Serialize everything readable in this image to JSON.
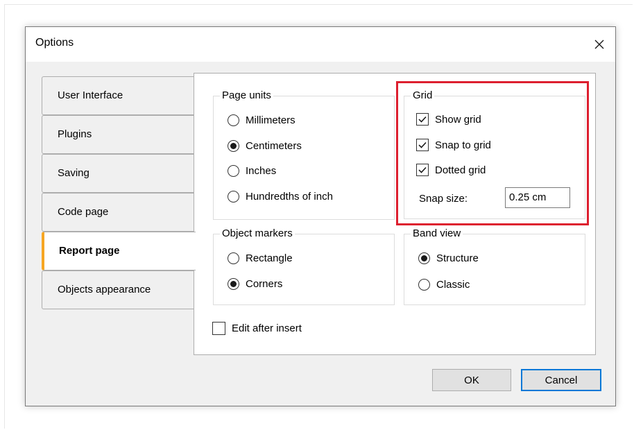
{
  "window": {
    "title": "Options"
  },
  "tabs": [
    {
      "label": "User Interface",
      "active": false
    },
    {
      "label": "Plugins",
      "active": false
    },
    {
      "label": "Saving",
      "active": false
    },
    {
      "label": "Code page",
      "active": false
    },
    {
      "label": "Report page",
      "active": true
    },
    {
      "label": "Objects appearance",
      "active": false
    }
  ],
  "page_units": {
    "title": "Page units",
    "options": [
      "Millimeters",
      "Centimeters",
      "Inches",
      "Hundredths of inch"
    ],
    "selected": "Centimeters"
  },
  "grid": {
    "title": "Grid",
    "show_grid": {
      "label": "Show grid",
      "checked": true
    },
    "snap_to_grid": {
      "label": "Snap to grid",
      "checked": true
    },
    "dotted_grid": {
      "label": "Dotted grid",
      "checked": true
    },
    "snap_size": {
      "label": "Snap size:",
      "value": "0.25 cm"
    }
  },
  "object_markers": {
    "title": "Object markers",
    "options": [
      "Rectangle",
      "Corners"
    ],
    "selected": "Corners"
  },
  "band_view": {
    "title": "Band view",
    "options": [
      "Structure",
      "Classic"
    ],
    "selected": "Structure"
  },
  "edit_after_insert": {
    "label": "Edit after insert",
    "checked": false
  },
  "buttons": {
    "ok": "OK",
    "cancel": "Cancel"
  },
  "colors": {
    "highlight_frame": "#dd1f2f",
    "active_tab_accent": "#f6a623",
    "default_button_border": "#0078d7"
  }
}
